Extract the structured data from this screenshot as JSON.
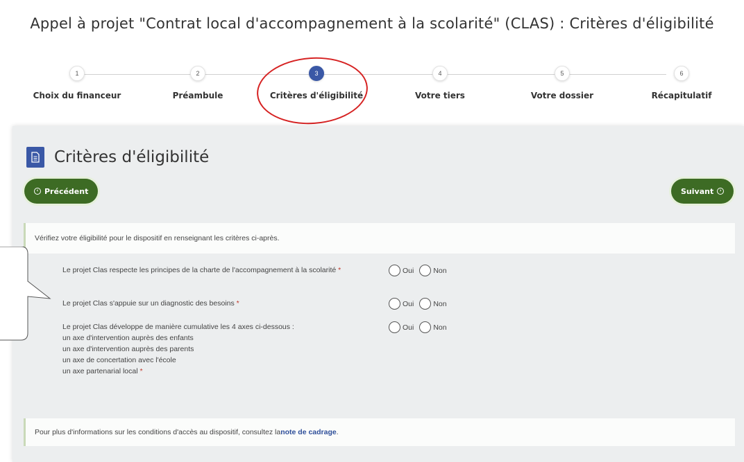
{
  "page": {
    "title": "Appel à projet \"Contrat local d'accompagnement à la scolarité\" (CLAS) : Critères d'éligibilité"
  },
  "stepper": {
    "steps": [
      {
        "number": "1",
        "label": "Choix du financeur",
        "active": false
      },
      {
        "number": "2",
        "label": "Préambule",
        "active": false
      },
      {
        "number": "3",
        "label": "Critères d'éligibilité",
        "active": true
      },
      {
        "number": "4",
        "label": "Votre tiers",
        "active": false
      },
      {
        "number": "5",
        "label": "Votre dossier",
        "active": false
      },
      {
        "number": "6",
        "label": "Récapitulatif",
        "active": false
      }
    ]
  },
  "panel": {
    "icon": "document-icon",
    "title": "Critères d'éligibilité",
    "prev_label": "Précédent",
    "next_label": "Suivant",
    "intro": "Vérifiez votre éligibilité pour le dispositif en renseignant les critères ci-après.",
    "criteria": [
      {
        "lines": [
          "Le projet Clas respecte les principes de la charte de l'accompagnement à la scolarité"
        ],
        "required": "*",
        "yes": "Oui",
        "no": "Non"
      },
      {
        "lines": [
          "Le projet Clas s'appuie sur un diagnostic des besoins"
        ],
        "required": "*",
        "yes": "Oui",
        "no": "Non"
      },
      {
        "lines": [
          "Le projet Clas développe de manière cumulative les 4 axes ci-dessous :",
          "un axe d'intervention auprès des enfants",
          "un axe d'intervention auprès des parents",
          "un axe de concertation avec l'école",
          "un axe partenarial local"
        ],
        "required": "*",
        "yes": "Oui",
        "no": "Non"
      }
    ],
    "footer_text": "Pour plus d'informations sur les conditions d'accès au dispositif, consultez la ",
    "footer_link": "note de cadrage",
    "footer_end": "."
  },
  "colors": {
    "accent": "#3a58a6",
    "button": "#3d6b24",
    "highlight": "#d62222"
  }
}
